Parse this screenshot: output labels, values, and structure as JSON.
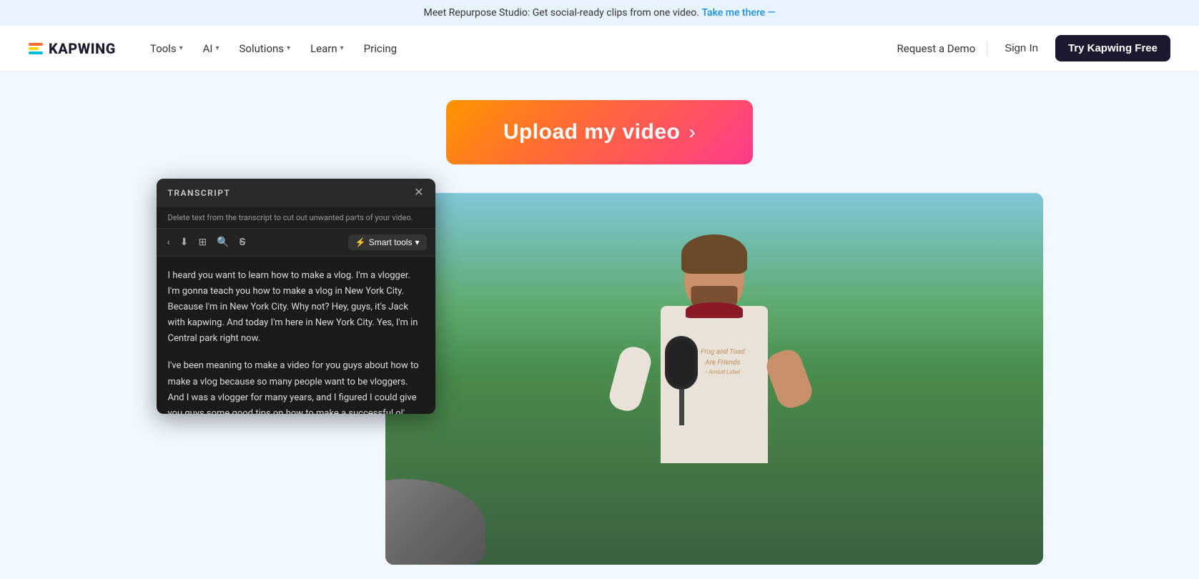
{
  "banner": {
    "text": "Meet Repurpose Studio: Get social-ready clips from one video.",
    "link_text": "Take me there —",
    "link_url": "#"
  },
  "navbar": {
    "logo_text": "KAPWING",
    "nav_items": [
      {
        "label": "Tools",
        "has_dropdown": true
      },
      {
        "label": "AI",
        "has_dropdown": true
      },
      {
        "label": "Solutions",
        "has_dropdown": true
      },
      {
        "label": "Learn",
        "has_dropdown": true
      },
      {
        "label": "Pricing",
        "has_dropdown": false
      }
    ],
    "request_demo": "Request a Demo",
    "sign_in": "Sign In",
    "try_free": "Try Kapwing Free"
  },
  "upload_button": {
    "label": "Upload my video",
    "chevron": "›"
  },
  "transcript": {
    "title": "TRANSCRIPT",
    "close_icon": "✕",
    "hint": "Delete text from the transcript to cut out unwanted parts of your video.",
    "toolbar": {
      "back_icon": "‹",
      "download_icon": "↓",
      "layout_icon": "▦",
      "search_icon": "🔍",
      "strikethrough_icon": "S̶",
      "smart_tools_label": "⚡ Smart tools ▾"
    },
    "paragraphs": [
      "I heard you want to learn how to make a vlog. I'm a vlogger. I'm gonna teach you how to make a vlog in New York City. Because I'm in New York City. Why not? Hey, guys, it's Jack with kapwing. And today I'm here in New York City. Yes, I'm in Central park right now.",
      "I've been meaning to make a video for you guys about how to make a vlog because so many people want to be vloggers. And I was a vlogger for many years, and I figured I could give you guys some good tips on how to make a successful ol' vlogs."
    ]
  },
  "shirt_text": {
    "line1": "Frog and Toad",
    "line2": "Are Friends",
    "line3": "• Arnold Lobel"
  }
}
